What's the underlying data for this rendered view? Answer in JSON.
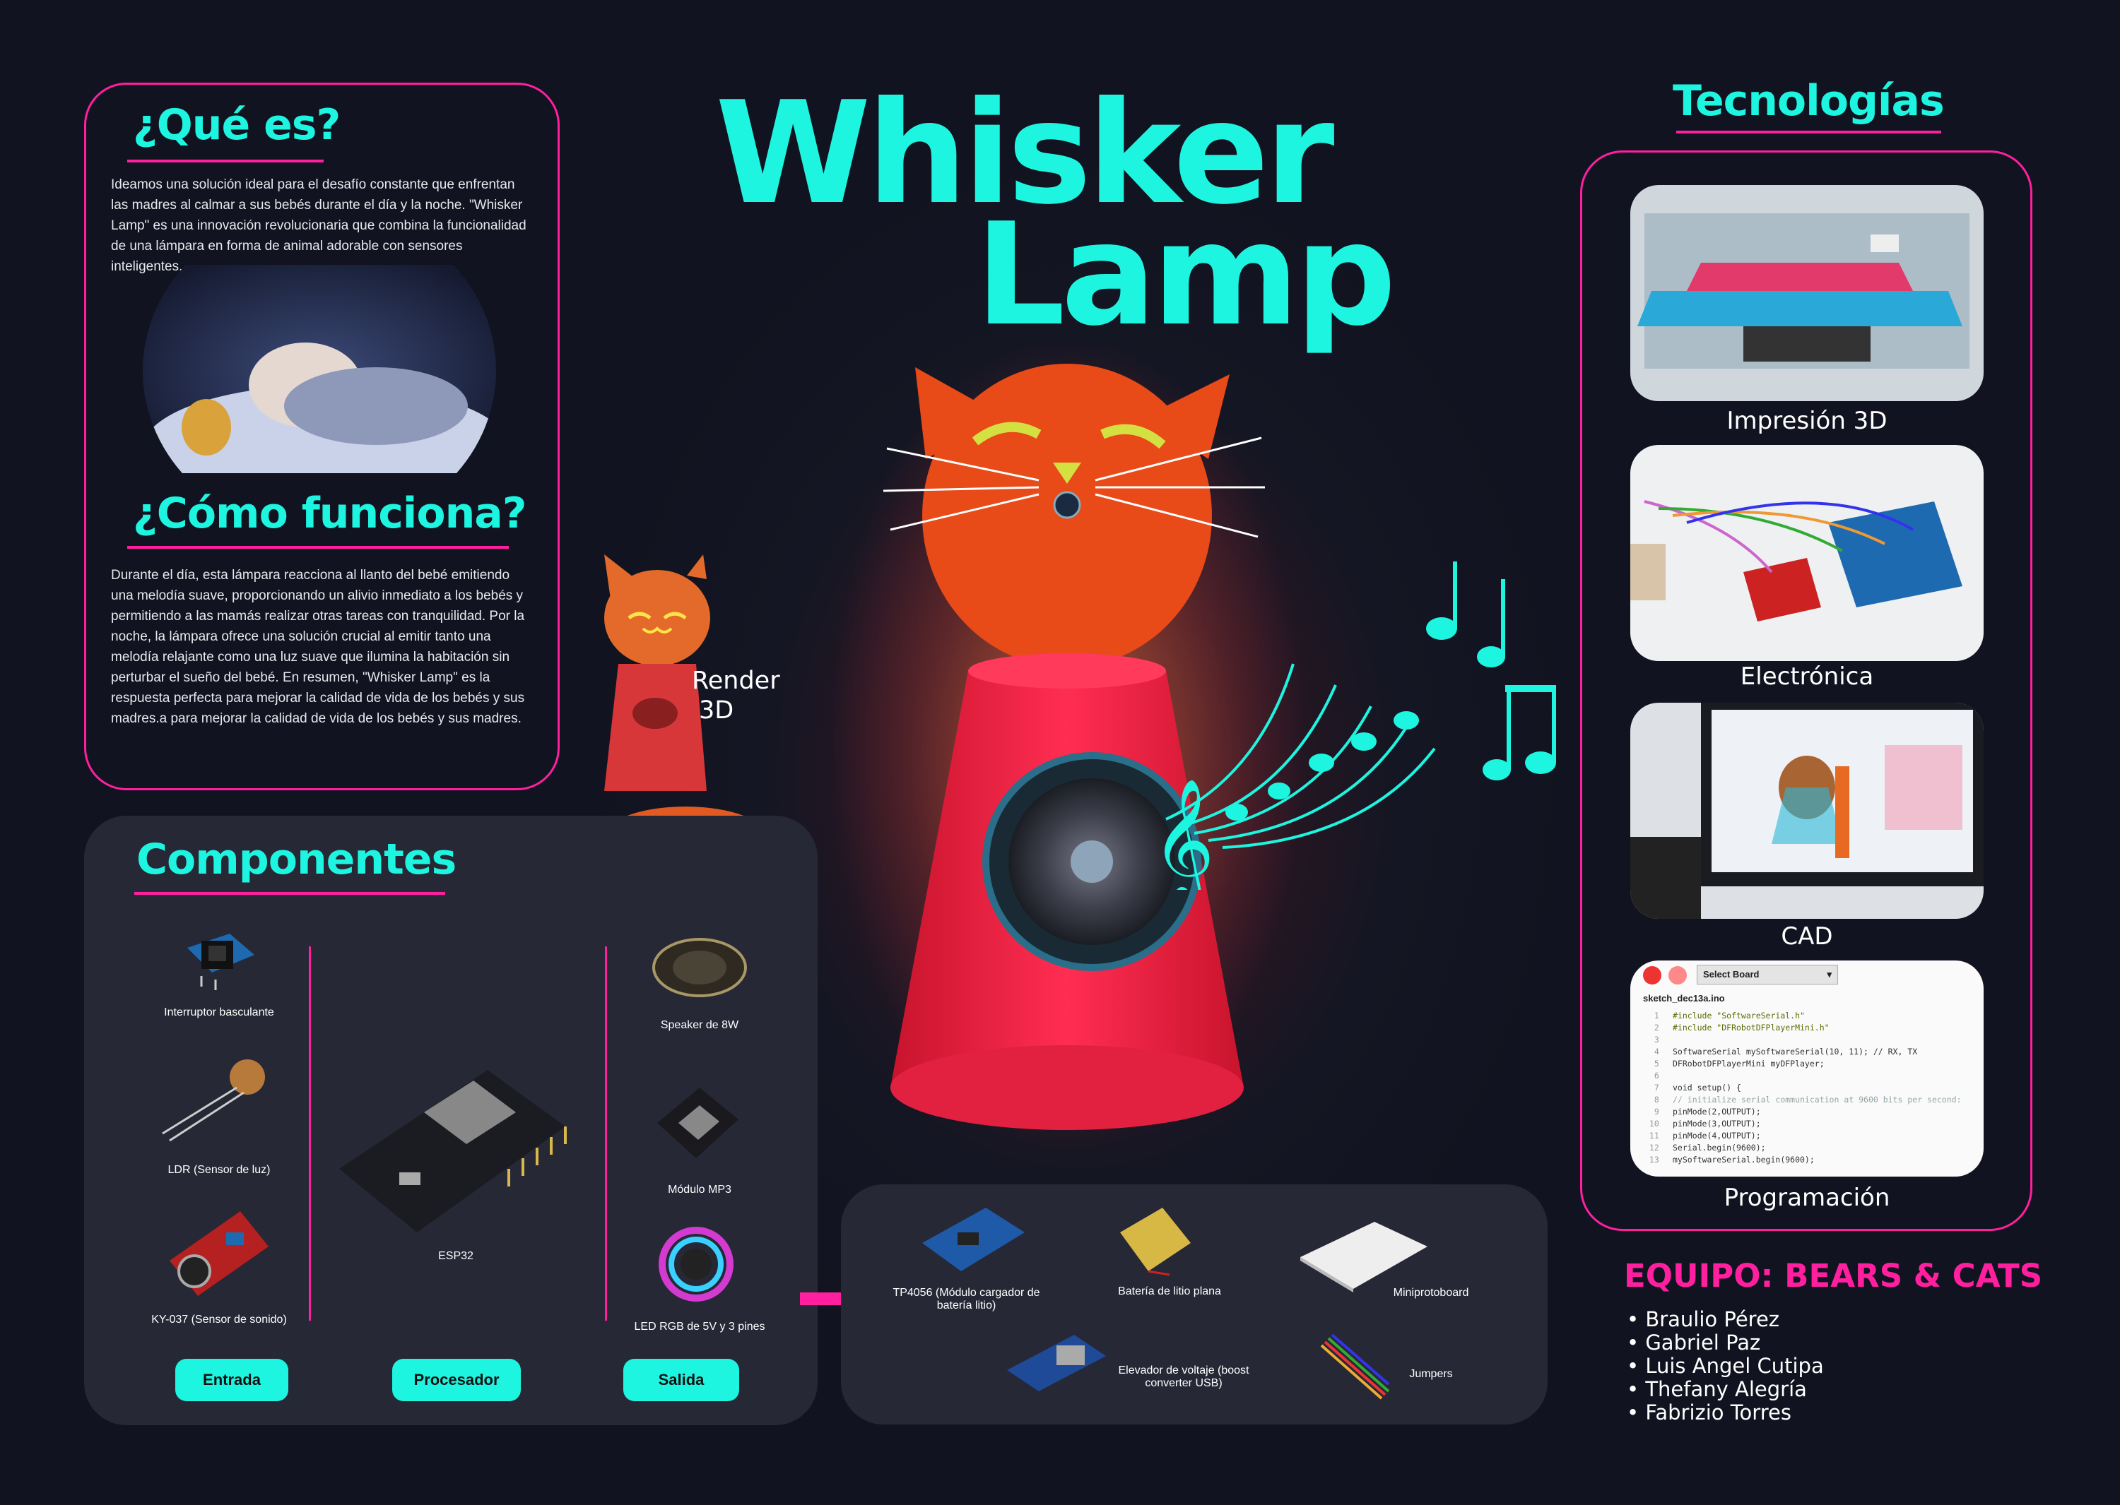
{
  "title": {
    "line1": "Whisker",
    "line2": "Lamp"
  },
  "que_es": {
    "heading": "¿Qué es?",
    "text": "Ideamos una solución ideal para el desafío constante que enfrentan las madres al calmar a sus bebés durante el día y la noche. \"Whisker Lamp\" es una innovación revolucionaria que combina la funcionalidad de una lámpara en forma de animal adorable con sensores inteligentes."
  },
  "como_funciona": {
    "heading": "¿Cómo funciona?",
    "text": "Durante el día, esta lámpara reacciona al llanto del bebé emitiendo una melodía suave, proporcionando un alivio inmediato a los bebés y permitiendo a las mamás realizar otras tareas con tranquilidad. Por la noche, la lámpara ofrece una solución crucial al emitir tanto una melodía relajante como una luz suave que ilumina la habitación sin perturbar el sueño del bebé. En resumen, \"Whisker Lamp\" es la respuesta perfecta para mejorar la calidad de vida de los bebés y sus madres.a para mejorar la calidad de vida de los bebés y sus madres."
  },
  "render_label": {
    "line1": "Render",
    "line2": "3D"
  },
  "componentes": {
    "heading": "Componentes",
    "entrada": [
      "Interruptor basculante",
      "LDR (Sensor de luz)",
      "KY-037 (Sensor de sonido)"
    ],
    "procesador": "ESP32",
    "salida": [
      "Speaker de 8W",
      "Módulo MP3",
      "LED RGB de 5V y 3 pines"
    ],
    "buttons": [
      "Entrada",
      "Procesador",
      "Salida"
    ]
  },
  "power": {
    "items": [
      "TP4056 (Módulo cargador de batería litio)",
      "Batería de litio plana",
      "Miniprotoboard",
      "Elevador de voltaje (boost converter USB)",
      "Jumpers"
    ]
  },
  "tecnologias": {
    "heading": "Tecnologías",
    "items": [
      "Impresión 3D",
      "Electrónica",
      "CAD",
      "Programación"
    ]
  },
  "code": {
    "select_board": "Select Board",
    "filename": "sketch_dec13a.ino",
    "lines": [
      "#include \"SoftwareSerial.h\"",
      "#include \"DFRobotDFPlayerMini.h\"",
      "",
      "SoftwareSerial mySoftwareSerial(10, 11); // RX, TX",
      "DFRobotDFPlayerMini myDFPlayer;",
      "",
      "void setup() {",
      "// initialize serial communication at 9600 bits per second:",
      "pinMode(2,OUTPUT);",
      "pinMode(3,OUTPUT);",
      "pinMode(4,OUTPUT);",
      "Serial.begin(9600);",
      "mySoftwareSerial.begin(9600);"
    ]
  },
  "equipo": {
    "heading": "EQUIPO: BEARS & CATS",
    "members": [
      "Braulio Pérez",
      "Gabriel Paz",
      "Luis Angel Cutipa",
      "Thefany Alegría",
      "Fabrizio Torres"
    ]
  },
  "colors": {
    "accent": "#1ef5e0",
    "border": "#ff1f9f",
    "lamp_head": "#e8501e",
    "lamp_body": "#ff2a55"
  }
}
